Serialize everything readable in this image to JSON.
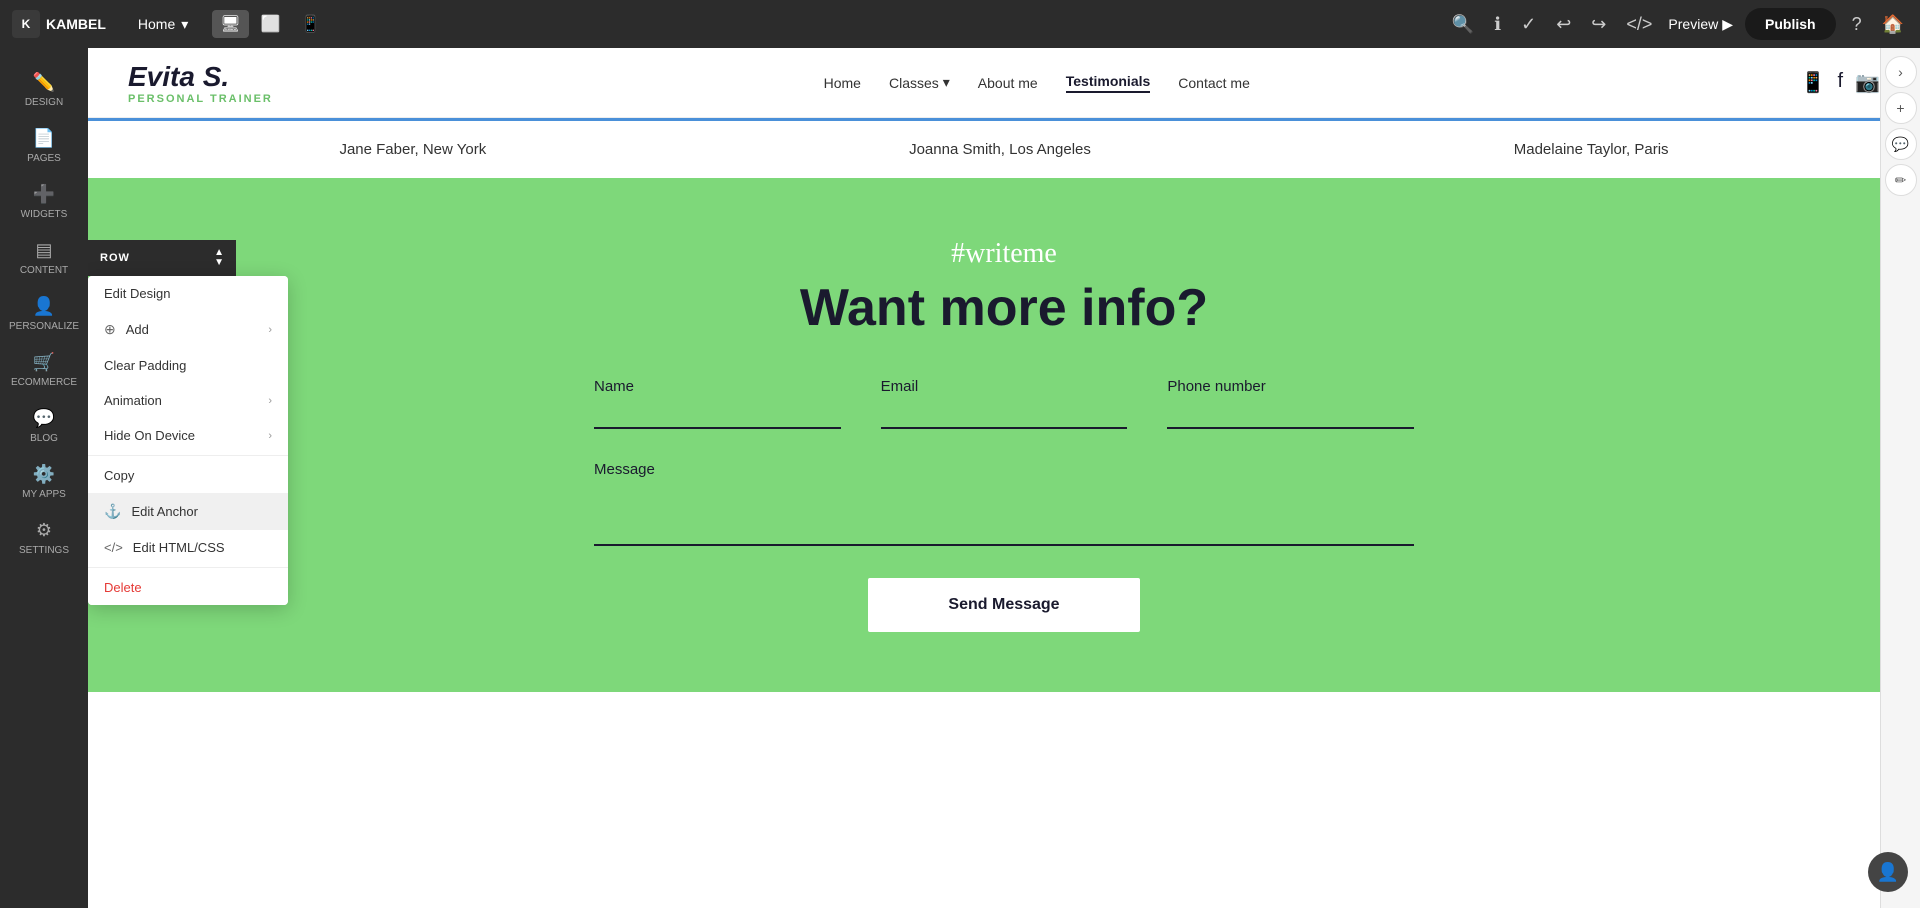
{
  "toolbar": {
    "logo": "KAMBEL",
    "page": "Home",
    "publish_label": "Publish",
    "preview_label": "Preview"
  },
  "sidebar": {
    "items": [
      {
        "id": "design",
        "icon": "✏️",
        "label": "DESIGN"
      },
      {
        "id": "pages",
        "icon": "📄",
        "label": "PAGES"
      },
      {
        "id": "widgets",
        "icon": "➕",
        "label": "WIDGETS"
      },
      {
        "id": "content",
        "icon": "📋",
        "label": "CONTENT"
      },
      {
        "id": "personalize",
        "icon": "👤",
        "label": "PERSONALIZE"
      },
      {
        "id": "ecommerce",
        "icon": "🛒",
        "label": "ECOMMERCE"
      },
      {
        "id": "blog",
        "icon": "💬",
        "label": "BLOG"
      },
      {
        "id": "my-apps",
        "icon": "⚙️",
        "label": "MY APPS"
      },
      {
        "id": "settings",
        "icon": "⚙️",
        "label": "SETTINGS"
      }
    ]
  },
  "site": {
    "logo_name": "Evita S.",
    "logo_sub": "PERSONAL TRAINER",
    "nav": [
      {
        "label": "Home",
        "active": false
      },
      {
        "label": "Classes",
        "active": false,
        "dropdown": true
      },
      {
        "label": "About me",
        "active": false
      },
      {
        "label": "Testimonials",
        "active": true
      },
      {
        "label": "Contact me",
        "active": false
      }
    ],
    "social": [
      "🟢",
      "🔵",
      "🟣"
    ]
  },
  "testimonials": [
    {
      "name": "Jane Faber, New York"
    },
    {
      "name": "Joanna Smith, Los Angeles"
    },
    {
      "name": "Madelaine Taylor, Paris"
    }
  ],
  "contact": {
    "hashtag": "#writeme",
    "title": "Want more info?",
    "fields": {
      "name": "Name",
      "email": "Email",
      "phone": "Phone number",
      "message": "Message"
    },
    "send_button": "Send Message"
  },
  "context_menu": {
    "row_label": "ROW",
    "items": [
      {
        "id": "edit-design",
        "label": "Edit Design",
        "icon": "",
        "arrow": false
      },
      {
        "id": "add",
        "label": "Add",
        "icon": "➕",
        "arrow": true
      },
      {
        "id": "clear-padding",
        "label": "Clear Padding",
        "icon": "",
        "arrow": false
      },
      {
        "id": "animation",
        "label": "Animation",
        "icon": "",
        "arrow": true
      },
      {
        "id": "hide-on-device",
        "label": "Hide On Device",
        "icon": "",
        "arrow": true
      },
      {
        "id": "copy",
        "label": "Copy",
        "icon": "",
        "arrow": false
      },
      {
        "id": "edit-anchor",
        "label": "Edit Anchor",
        "icon": "⚓",
        "arrow": false
      },
      {
        "id": "edit-html-css",
        "label": "Edit HTML/CSS",
        "icon": "</>",
        "arrow": false
      },
      {
        "id": "delete",
        "label": "Delete",
        "icon": "",
        "arrow": false,
        "danger": true
      }
    ]
  }
}
